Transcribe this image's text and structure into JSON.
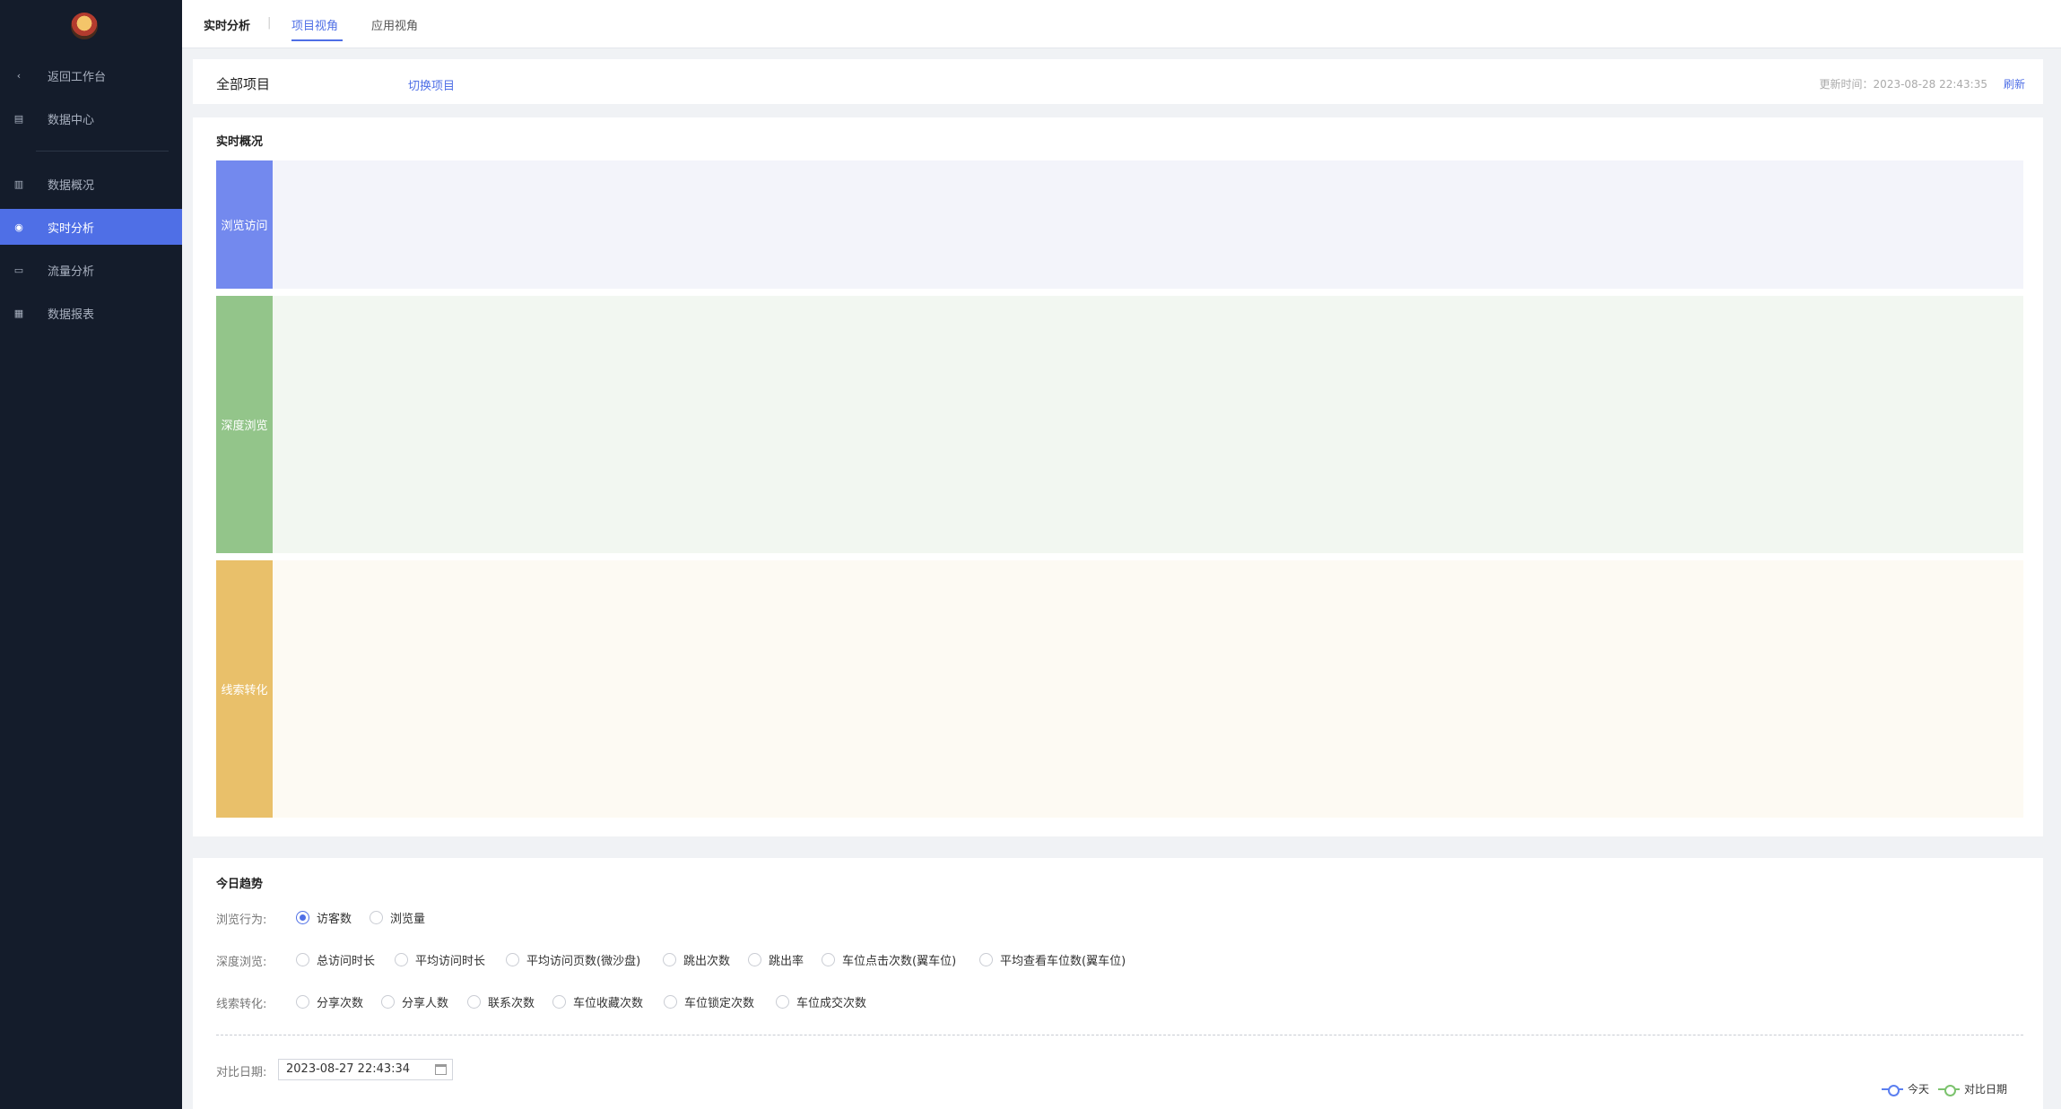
{
  "sidebar": {
    "items": [
      {
        "label": "返回工作台",
        "icon": "chevron-left-icon"
      },
      {
        "label": "数据中心",
        "icon": "chart-icon"
      },
      {
        "label": "数据概况",
        "icon": "bar-chart-icon"
      },
      {
        "label": "实时分析",
        "icon": "eye-icon",
        "active": true
      },
      {
        "label": "流量分析",
        "icon": "monitor-icon"
      },
      {
        "label": "数据报表",
        "icon": "report-icon"
      }
    ]
  },
  "topbar": {
    "title": "实时分析",
    "separator": "|",
    "tabs": [
      {
        "label": "项目视角",
        "active": true
      },
      {
        "label": "应用视角",
        "active": false
      }
    ]
  },
  "project": {
    "name": "全部项目",
    "switch_label": "切换项目",
    "update_time": "更新时间：2023-08-28 22:43:35",
    "refresh_label": "刷新"
  },
  "overview": {
    "title": "实时概况",
    "bands": [
      {
        "label": "浏览访问",
        "color": "#7389ee",
        "bg": "#f3f4fa"
      },
      {
        "label": "深度浏览",
        "color": "#93c58a",
        "bg": "#f2f7f1"
      },
      {
        "label": "线索转化",
        "color": "#e9c06a",
        "bg": "#fdfaf3"
      }
    ]
  },
  "trend": {
    "title": "今日趋势",
    "rows": [
      {
        "label": "浏览行为:",
        "options": [
          "访客数",
          "浏览量"
        ],
        "checked": 0
      },
      {
        "label": "深度浏览:",
        "options": [
          "总访问时长",
          "平均访问时长",
          "平均访问页数(微沙盘)",
          "跳出次数",
          "跳出率",
          "车位点击次数(翼车位)",
          "平均查看车位数(翼车位)"
        ]
      },
      {
        "label": "线索转化:",
        "options": [
          "分享次数",
          "分享人数",
          "联系次数",
          "车位收藏次数",
          "车位锁定次数",
          "车位成交次数"
        ]
      }
    ],
    "compare_label": "对比日期:",
    "compare_date": "2023-08-27 22:43:34",
    "legend": [
      {
        "label": "今天",
        "color": "#5b7ff0"
      },
      {
        "label": "对比日期",
        "color": "#7cc36e"
      }
    ]
  }
}
